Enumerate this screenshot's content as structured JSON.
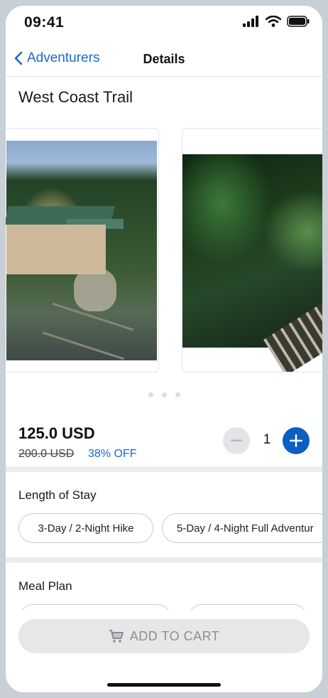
{
  "status_bar": {
    "time": "09:41"
  },
  "nav": {
    "back_label": "Adventurers",
    "title": "Details"
  },
  "product": {
    "title": "West Coast Trail",
    "price": "125.0 USD",
    "original_price": "200.0 USD",
    "discount": "38% OFF",
    "quantity": "1",
    "images": [
      "lodge-photo",
      "forest-boardwalk-photo"
    ]
  },
  "length_of_stay": {
    "heading": "Length of Stay",
    "options": [
      "3-Day / 2-Night Hike",
      "5-Day / 4-Night Full Adventur"
    ]
  },
  "meal_plan": {
    "heading": "Meal Plan"
  },
  "cart": {
    "label": "ADD TO CART"
  },
  "colors": {
    "accent": "#1a6ac7",
    "primary_button": "#0b5fc0"
  },
  "carousel": {
    "page_count": 3
  }
}
